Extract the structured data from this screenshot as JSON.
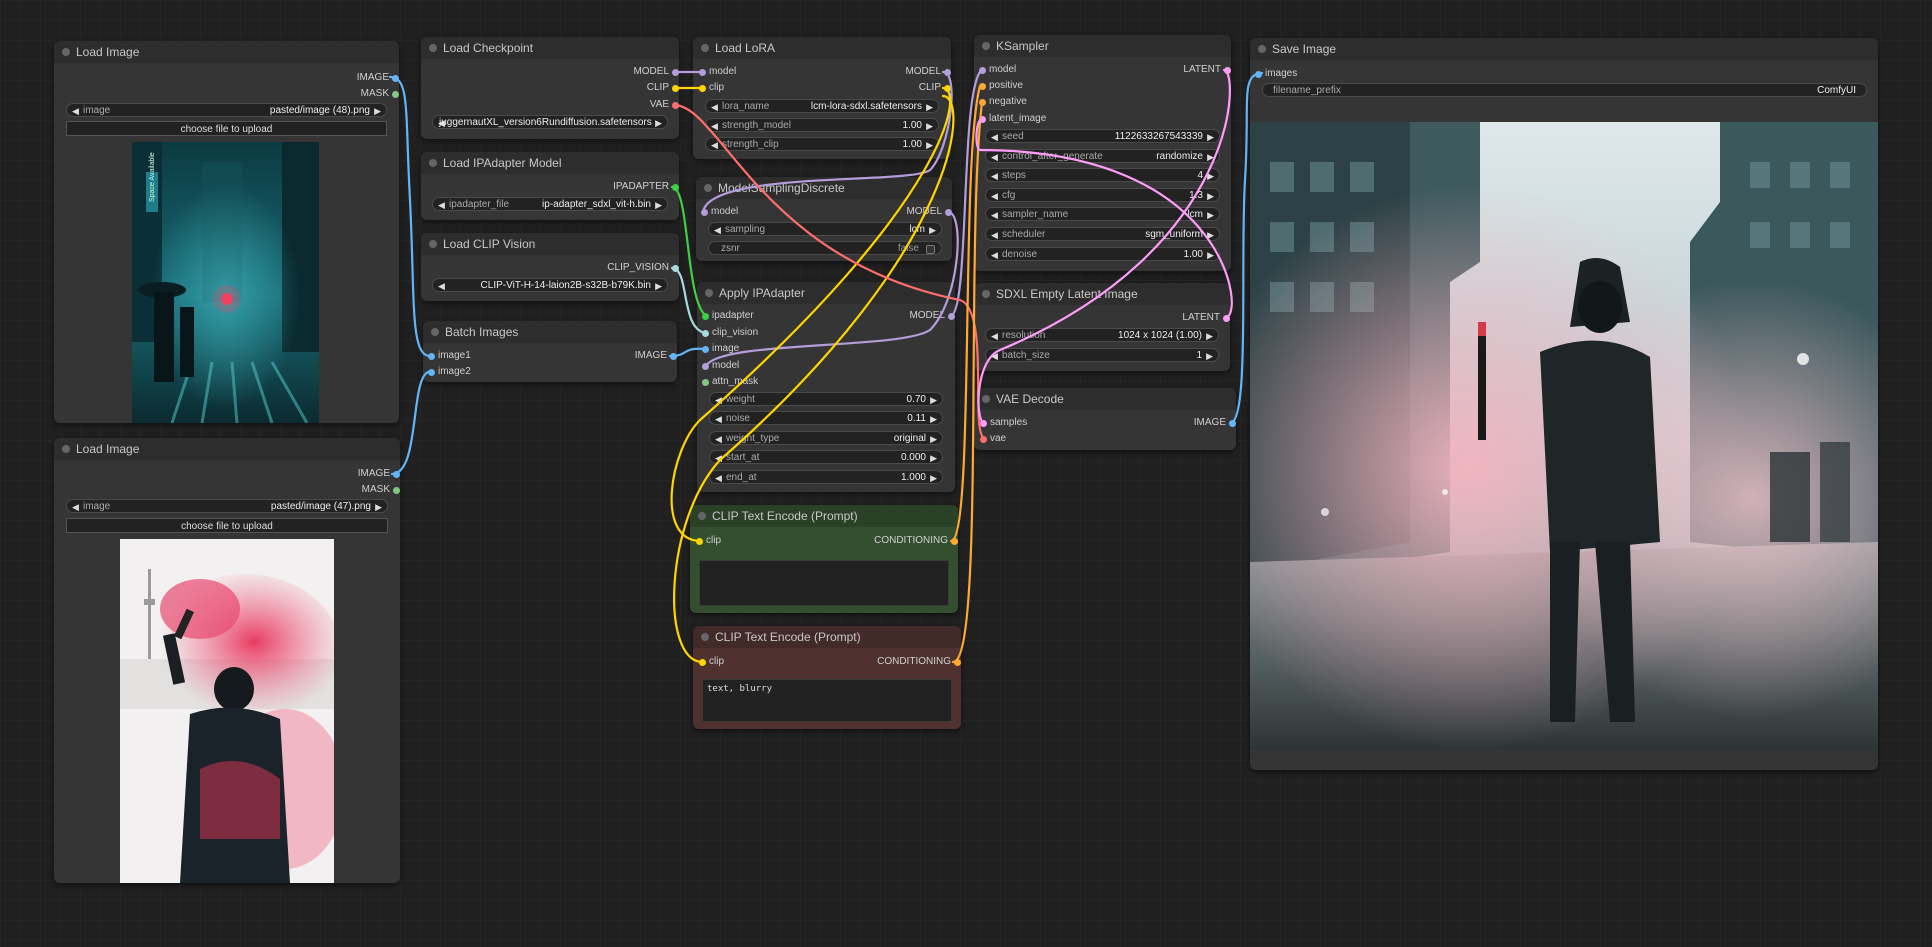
{
  "colors": {
    "model": "#b39ddb",
    "clip": "#ffd500",
    "vae": "#ff6e6e",
    "image": "#64b5f6",
    "mask": "#81c784",
    "latent": "#ff9cf9",
    "conditioning": "#ffa931",
    "ipadapter": "#3fce46",
    "clip_vision": "#a8dadc"
  },
  "load_image_1": {
    "title": "Load Image",
    "out_image": "IMAGE",
    "out_mask": "MASK",
    "image_label": "image",
    "image_value": "pasted/image (48).png",
    "upload_label": "choose file to upload"
  },
  "load_image_2": {
    "title": "Load Image",
    "out_image": "IMAGE",
    "out_mask": "MASK",
    "image_label": "image",
    "image_value": "pasted/image (47).png",
    "upload_label": "choose file to upload"
  },
  "load_checkpoint": {
    "title": "Load Checkpoint",
    "out_model": "MODEL",
    "out_clip": "CLIP",
    "out_vae": "VAE",
    "ckpt_value": "juggernautXL_version6Rundiffusion.safetensors"
  },
  "load_ipadapter_model": {
    "title": "Load IPAdapter Model",
    "out": "IPADAPTER",
    "file_label": "ipadapter_file",
    "file_value": "ip-adapter_sdxl_vit-h.bin"
  },
  "load_clip_vision": {
    "title": "Load CLIP Vision",
    "out": "CLIP_VISION",
    "clip_value": "CLIP-ViT-H-14-laion2B-s32B-b79K.bin"
  },
  "batch_images": {
    "title": "Batch Images",
    "in_image1": "image1",
    "in_image2": "image2",
    "out": "IMAGE"
  },
  "load_lora": {
    "title": "Load LoRA",
    "in_model": "model",
    "in_clip": "clip",
    "out_model": "MODEL",
    "out_clip": "CLIP",
    "widgets": [
      {
        "label": "lora_name",
        "value": "lcm-lora-sdxl.safetensors"
      },
      {
        "label": "strength_model",
        "value": "1.00"
      },
      {
        "label": "strength_clip",
        "value": "1.00"
      }
    ]
  },
  "model_sampling": {
    "title": "ModelSamplingDiscrete",
    "in_model": "model",
    "out_model": "MODEL",
    "sampling_label": "sampling",
    "sampling_value": "lcm",
    "zsnr_label": "zsnr",
    "zsnr_value": "false"
  },
  "apply_ipadapter": {
    "title": "Apply IPAdapter",
    "inputs": [
      "ipadapter",
      "clip_vision",
      "image",
      "model",
      "attn_mask"
    ],
    "out_model": "MODEL",
    "widgets": [
      {
        "label": "weight",
        "value": "0.70"
      },
      {
        "label": "noise",
        "value": "0.11"
      },
      {
        "label": "weight_type",
        "value": "original"
      },
      {
        "label": "start_at",
        "value": "0.000"
      },
      {
        "label": "end_at",
        "value": "1.000"
      }
    ]
  },
  "clip_pos": {
    "title": "CLIP Text Encode (Prompt)",
    "in_clip": "clip",
    "out": "CONDITIONING",
    "text": ""
  },
  "clip_neg": {
    "title": "CLIP Text Encode (Prompt)",
    "in_clip": "clip",
    "out": "CONDITIONING",
    "text": "text, blurry"
  },
  "ksampler": {
    "title": "KSampler",
    "inputs": [
      "model",
      "positive",
      "negative",
      "latent_image"
    ],
    "out": "LATENT",
    "widgets": [
      {
        "label": "seed",
        "value": "1122633267543339"
      },
      {
        "label": "control_after_generate",
        "value": "randomize"
      },
      {
        "label": "steps",
        "value": "4"
      },
      {
        "label": "cfg",
        "value": "1.3"
      },
      {
        "label": "sampler_name",
        "value": "lcm"
      },
      {
        "label": "scheduler",
        "value": "sgm_uniform"
      },
      {
        "label": "denoise",
        "value": "1.00"
      }
    ]
  },
  "empty_latent": {
    "title": "SDXL Empty Latent Image",
    "out": "LATENT",
    "widgets": [
      {
        "label": "resolution",
        "value": "1024 x 1024 (1.00)"
      },
      {
        "label": "batch_size",
        "value": "1"
      }
    ]
  },
  "vae_decode": {
    "title": "VAE Decode",
    "in_samples": "samples",
    "in_vae": "vae",
    "out": "IMAGE"
  },
  "save_image": {
    "title": "Save Image",
    "in_images": "images",
    "prefix_label": "filename_prefix",
    "prefix_value": "ComfyUI"
  },
  "preview_1": {
    "sign_text": "Space Available"
  }
}
